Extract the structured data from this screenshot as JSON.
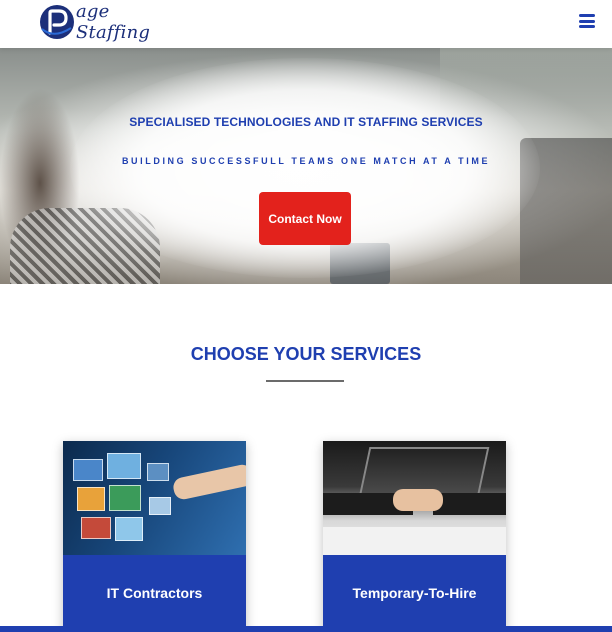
{
  "navbar": {
    "logo_text": "age Staffing",
    "logo_icon": "page-staffing-logo",
    "menu_icon": "hamburger-menu-icon"
  },
  "hero": {
    "title": "SPECIALISED TECHNOLOGIES AND IT STAFFING SERVICES",
    "subtitle": "BUILDING SUCCESSFULL TEAMS ONE MATCH AT A TIME",
    "cta_label": "Contact Now"
  },
  "services": {
    "title": "CHOOSE YOUR SERVICES",
    "cards": [
      {
        "label": "IT Contractors",
        "image": "digital-screens-hand-image"
      },
      {
        "label": "Temporary-To-Hire",
        "image": "handshake-laptop-image"
      }
    ]
  },
  "colors": {
    "brand_blue": "#1f3fb0",
    "cta_red": "#e3221c",
    "navy": "#1c2f7a"
  }
}
